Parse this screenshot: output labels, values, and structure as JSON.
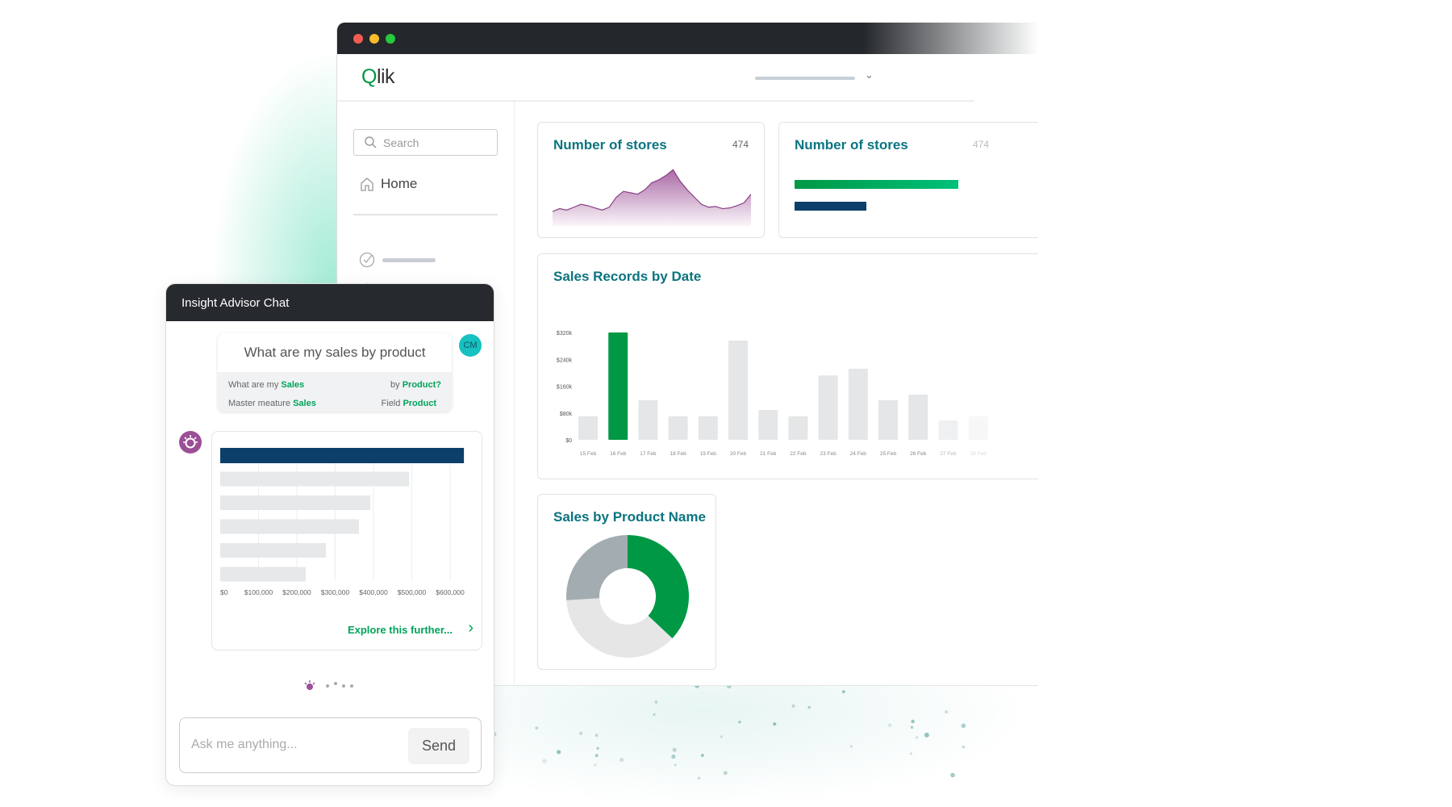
{
  "app": {
    "logo_text": "Qlik",
    "window_controls": [
      "close",
      "minimize",
      "maximize"
    ],
    "colors": {
      "brand_green": "#009845",
      "title_teal": "#0b7480",
      "navy": "#0d3f6b",
      "purple": "#9b4f96",
      "titlebar": "#24272b"
    }
  },
  "sidebar": {
    "search_placeholder": "Search",
    "home_label": "Home",
    "icons": [
      "search-icon",
      "home-icon",
      "check-circle-icon",
      "star-icon"
    ]
  },
  "cards": {
    "stores1": {
      "title": "Number of stores",
      "value": "474",
      "sparkline": [
        20,
        24,
        22,
        26,
        30,
        28,
        25,
        22,
        26,
        40,
        48,
        46,
        44,
        50,
        60,
        64,
        70,
        78,
        62,
        50,
        40,
        30,
        26,
        27,
        24,
        25,
        28,
        32,
        44
      ]
    },
    "stores2": {
      "title": "Number of stores",
      "value": "474",
      "bars": [
        {
          "color": "#00a35a",
          "fraction": 1.0
        },
        {
          "color": "#0d3f6b",
          "fraction": 0.44
        }
      ]
    },
    "sales_by_date": {
      "title": "Sales Records by Date"
    },
    "sales_by_product": {
      "title": "Sales by Product Name"
    }
  },
  "chart_data": [
    {
      "type": "bar",
      "title": "Sales Records by Date",
      "categories": [
        "15 Feb",
        "16 Feb",
        "17 Feb",
        "18 Feb",
        "19 Feb",
        "20 Feb",
        "21 Feb",
        "22 Feb",
        "23 Feb",
        "24 Feb",
        "25 Feb",
        "26 Feb",
        "27 Feb",
        "28 Feb"
      ],
      "values": [
        70000,
        320000,
        118000,
        70000,
        70000,
        296000,
        89000,
        70000,
        192000,
        212000,
        118000,
        135000,
        58000,
        70000
      ],
      "highlight_index": 1,
      "y_ticks": [
        "$0",
        "$80k",
        "$160k",
        "$240k",
        "$320k"
      ],
      "ylim": [
        0,
        320000
      ],
      "grid": false
    },
    {
      "type": "pie",
      "title": "Sales by Product Name",
      "donut": true,
      "values": [
        37,
        37,
        26
      ],
      "colors": [
        "#009845",
        "#e6e6e6",
        "#a3acb0"
      ]
    },
    {
      "type": "bar",
      "orientation": "horizontal",
      "values": [
        636000,
        493000,
        392000,
        362000,
        276000,
        223000
      ],
      "x_ticks": [
        "$0",
        "$100,000",
        "$200,000",
        "$300,000",
        "$400,000",
        "$500,000",
        "$600,000"
      ],
      "xlim": [
        0,
        600000
      ],
      "grid": true
    }
  ],
  "chat": {
    "title": "Insight Advisor Chat",
    "user_initials": "CM",
    "question": "What are my sales by product",
    "interp": {
      "left1": "What are my ",
      "left1_hl": "Sales",
      "right1": "by ",
      "right1_hl": "Product?",
      "left2": "Master meature ",
      "left2_hl": "Sales",
      "right2": "Field ",
      "right2_hl": "Product"
    },
    "explore_label": "Explore this further...",
    "input_placeholder": "Ask me anything...",
    "send_label": "Send"
  }
}
